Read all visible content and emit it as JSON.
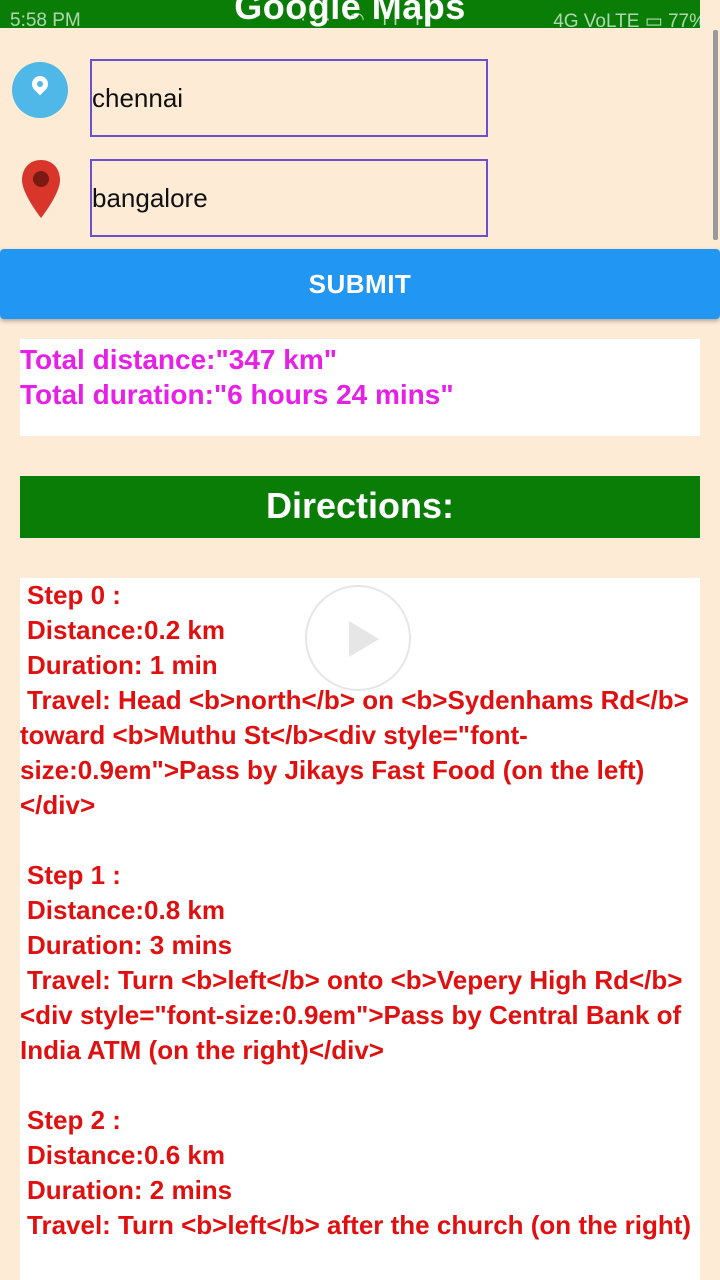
{
  "status": {
    "time": "5:58 PM",
    "network": "4G VoLTE",
    "battery": "77%"
  },
  "app": {
    "title": "Google Maps"
  },
  "origin": {
    "value": "chennai",
    "icon": "origin-pin-icon"
  },
  "destination": {
    "value": "bangalore",
    "icon": "destination-pin-icon"
  },
  "submit": {
    "label": "SUBMIT"
  },
  "summary": {
    "distance": "Total distance:\"347 km\"",
    "duration": "Total duration:\"6 hours 24 mins\""
  },
  "directions": {
    "header": "Directions:",
    "steps": [
      {
        "title": "Step 0 :",
        "distance": "Distance:0.2 km",
        "duration": "Duration: 1 min",
        "travel": "Travel:  Head <b>north</b> on <b>Sydenhams Rd</b> toward <b>Muthu St</b><div style=\"font-size:0.9em\">Pass by Jikays Fast Food (on the left)</div>"
      },
      {
        "title": "Step 1 :",
        "distance": "Distance:0.8 km",
        "duration": "Duration: 3 mins",
        "travel": "Travel:  Turn <b>left</b> onto <b>Vepery High Rd</b><div style=\"font-size:0.9em\">Pass by Central Bank of India ATM (on the right)</div>"
      },
      {
        "title": "Step 2 :",
        "distance": "Distance:0.6 km",
        "duration": "Duration: 2 mins",
        "travel": "Travel:  Turn <b>left</b> after the church (on the right)"
      }
    ]
  },
  "colors": {
    "background": "#fdebd6",
    "green": "#0a7d06",
    "submit": "#2196f3",
    "summary_text": "#e620e6",
    "directions_text": "#e01010"
  }
}
